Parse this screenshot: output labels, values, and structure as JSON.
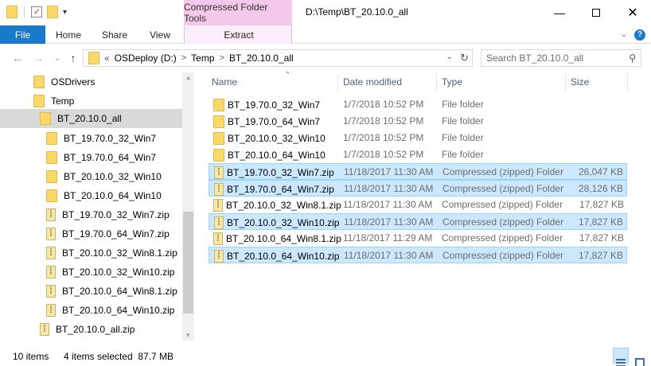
{
  "titlebar": {
    "context_tab": "Compressed Folder Tools",
    "path": "D:\\Temp\\BT_20.10.0_all"
  },
  "ribbon": {
    "tabs": [
      {
        "label": "File"
      },
      {
        "label": "Home"
      },
      {
        "label": "Share"
      },
      {
        "label": "View"
      },
      {
        "label": "Extract"
      }
    ]
  },
  "address": {
    "overflow": "«",
    "crumbs": [
      "OSDeploy (D:)",
      "Temp",
      "BT_20.10.0_all"
    ],
    "search_placeholder": "Search BT_20.10.0_all"
  },
  "navpane": {
    "items": [
      {
        "label": "OSDrivers",
        "icon": "folder",
        "selected": false
      },
      {
        "label": "Temp",
        "icon": "folder",
        "selected": false
      },
      {
        "label": "BT_20.10.0_all",
        "icon": "folder",
        "selected": true
      },
      {
        "label": "BT_19.70.0_32_Win7",
        "icon": "folder",
        "selected": false
      },
      {
        "label": "BT_19.70.0_64_Win7",
        "icon": "folder",
        "selected": false
      },
      {
        "label": "BT_20.10.0_32_Win10",
        "icon": "folder",
        "selected": false
      },
      {
        "label": "BT_20.10.0_64_Win10",
        "icon": "folder",
        "selected": false
      },
      {
        "label": "BT_19.70.0_32_Win7.zip",
        "icon": "zip",
        "selected": false
      },
      {
        "label": "BT_19.70.0_64_Win7.zip",
        "icon": "zip",
        "selected": false
      },
      {
        "label": "BT_20.10.0_32_Win8.1.zip",
        "icon": "zip",
        "selected": false
      },
      {
        "label": "BT_20.10.0_32_Win10.zip",
        "icon": "zip",
        "selected": false
      },
      {
        "label": "BT_20.10.0_64_Win8.1.zip",
        "icon": "zip",
        "selected": false
      },
      {
        "label": "BT_20.10.0_64_Win10.zip",
        "icon": "zip",
        "selected": false
      },
      {
        "label": "BT_20.10.0_all.zip",
        "icon": "zip",
        "selected": false
      }
    ]
  },
  "columns": {
    "name": "Name",
    "date": "Date modified",
    "type": "Type",
    "size": "Size"
  },
  "files": [
    {
      "name": "BT_19.70.0_32_Win7",
      "date": "1/7/2018 10:52 PM",
      "type": "File folder",
      "size": "",
      "icon": "folder",
      "selected": false
    },
    {
      "name": "BT_19.70.0_64_Win7",
      "date": "1/7/2018 10:52 PM",
      "type": "File folder",
      "size": "",
      "icon": "folder",
      "selected": false
    },
    {
      "name": "BT_20.10.0_32_Win10",
      "date": "1/7/2018 10:52 PM",
      "type": "File folder",
      "size": "",
      "icon": "folder",
      "selected": false
    },
    {
      "name": "BT_20.10.0_64_Win10",
      "date": "1/7/2018 10:52 PM",
      "type": "File folder",
      "size": "",
      "icon": "folder",
      "selected": false
    },
    {
      "name": "BT_19.70.0_32_Win7.zip",
      "date": "11/18/2017 11:30 AM",
      "type": "Compressed (zipped) Folder",
      "size": "26,047 KB",
      "icon": "zip",
      "selected": true
    },
    {
      "name": "BT_19.70.0_64_Win7.zip",
      "date": "11/18/2017 11:30 AM",
      "type": "Compressed (zipped) Folder",
      "size": "28,126 KB",
      "icon": "zip",
      "selected": true
    },
    {
      "name": "BT_20.10.0_32_Win8.1.zip",
      "date": "11/18/2017 11:30 AM",
      "type": "Compressed (zipped) Folder",
      "size": "17,827 KB",
      "icon": "zip",
      "selected": false
    },
    {
      "name": "BT_20.10.0_32_Win10.zip",
      "date": "11/18/2017 11:30 AM",
      "type": "Compressed (zipped) Folder",
      "size": "17,827 KB",
      "icon": "zip",
      "selected": true
    },
    {
      "name": "BT_20.10.0_64_Win8.1.zip",
      "date": "11/18/2017 11:29 AM",
      "type": "Compressed (zipped) Folder",
      "size": "17,827 KB",
      "icon": "zip",
      "selected": false
    },
    {
      "name": "BT_20.10.0_64_Win10.zip",
      "date": "11/18/2017 11:30 AM",
      "type": "Compressed (zipped) Folder",
      "size": "17,827 KB",
      "icon": "zip",
      "selected": true
    }
  ],
  "status": {
    "item_count": "10 items",
    "selected": "4 items selected  87.7 MB"
  },
  "colors": {
    "file_tab": "#1979ca",
    "context_tab": "#f3c8e8",
    "selection": "#cce8ff",
    "selection_border": "#99d1ff"
  }
}
